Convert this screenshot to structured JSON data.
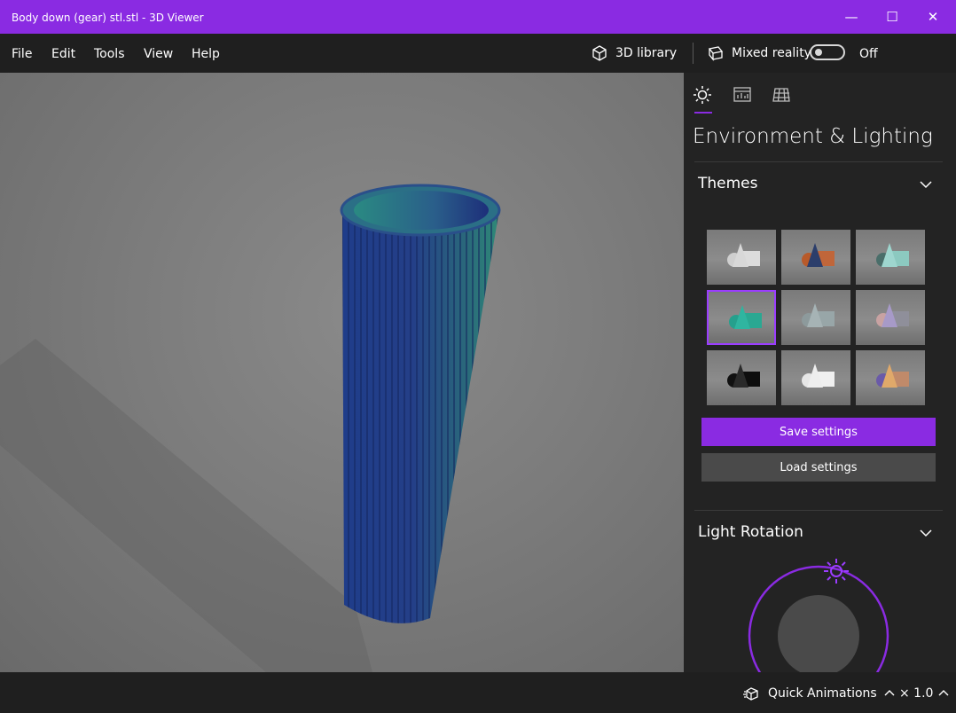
{
  "window": {
    "title": "Body down (gear) stl.stl - 3D Viewer",
    "minimize_glyph": "—",
    "maximize_glyph": "☐",
    "close_glyph": "✕",
    "accent": "#8a2be2"
  },
  "menu": {
    "items": [
      {
        "label": "File"
      },
      {
        "label": "Edit"
      },
      {
        "label": "Tools"
      },
      {
        "label": "View"
      },
      {
        "label": "Help"
      }
    ],
    "library_label": "3D library",
    "mixed_reality_label": "Mixed reality",
    "mixed_reality_state": "Off"
  },
  "panel": {
    "tabs": [
      {
        "name": "environment-lighting",
        "icon": "sun-icon"
      },
      {
        "name": "stats-shading",
        "icon": "chart-icon"
      },
      {
        "name": "mesh-grid",
        "icon": "grid-icon"
      }
    ],
    "title": "Environment & Lighting",
    "themes": {
      "heading": "Themes",
      "selected_index": 3,
      "thumbnails": [
        {
          "cone": "#d8d8d8",
          "sphere": "#cfcfcf",
          "cube": "#dcdcdc"
        },
        {
          "cone": "#2c3e6b",
          "sphere": "#b85a2a",
          "cube": "#c0663a"
        },
        {
          "cone": "#9ed6cf",
          "sphere": "#4a6e6a",
          "cube": "#8cc9c0"
        },
        {
          "cone": "#2fb5a0",
          "sphere": "#25a08d",
          "cube": "#2aa892"
        },
        {
          "cone": "#a6b3b5",
          "sphere": "#8d9a9c",
          "cube": "#98a6a8"
        },
        {
          "cone": "#a79ac8",
          "sphere": "#c8a2a2",
          "cube": "#8f8f9a"
        },
        {
          "cone": "#2a2a2a",
          "sphere": "#111111",
          "cube": "#0d0d0d"
        },
        {
          "cone": "#eeeeee",
          "sphere": "#e6e6e6",
          "cube": "#f0f0f0"
        },
        {
          "cone": "#e0a96a",
          "sphere": "#6a5aa8",
          "cube": "#c08a6a"
        }
      ],
      "save_label": "Save settings",
      "load_label": "Load settings"
    },
    "light_rotation": {
      "heading": "Light Rotation"
    }
  },
  "status": {
    "animations_label": "Quick Animations",
    "speed_label": "× 1.0"
  }
}
